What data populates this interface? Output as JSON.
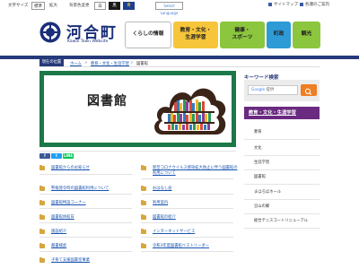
{
  "utility": {
    "text_size_label": "文字サイズ",
    "size_standard": "標準",
    "size_large": "拡大",
    "bg_color_label": "背景色変更",
    "color_white": "白",
    "color_black": "黒",
    "color_blue": "青",
    "language_button": "Select Language",
    "sitemap": "サイトマップ",
    "contact": "各課のご案内"
  },
  "logo": {
    "name": "河合町",
    "subtitle": "Kawai Town Website"
  },
  "global_nav": [
    {
      "label": "くらしの情報"
    },
    {
      "label": "教育・文化・生涯学習"
    },
    {
      "label": "健康・スポーツ"
    },
    {
      "label": "町政"
    },
    {
      "label": "観光"
    }
  ],
  "breadcrumb": {
    "position_label": "現在の位置",
    "items": [
      "ホーム",
      "教育・文化・生涯学習",
      "図書館"
    ],
    "separator": ">"
  },
  "hero": {
    "title": "図書館"
  },
  "social": {
    "facebook": "f",
    "twitter": "t",
    "line": "LINE"
  },
  "links": [
    [
      "図書館からのお知らせ",
      "新型コロナウイルス感染拡大防止に伴う図書館の利用について"
    ],
    [
      "警報発令時の図書館利用について",
      "おはなし会"
    ],
    [
      "図書館特設コーナー",
      "利用案内"
    ],
    [
      "図書館休館日",
      "図書館の紹介"
    ],
    [
      "施設紹介",
      "インターネットサービス"
    ],
    [
      "蔵書検索",
      "令和3年度図書館ベストリーダー"
    ],
    [
      "子育て支援図書室事業",
      ""
    ]
  ],
  "sidebar": {
    "keyword_title": "キーワード検索",
    "search_placeholder": "Google 提供",
    "search_brand": "Google",
    "section_title": "教育・文化・生涯学習",
    "items": [
      {
        "label": "教育",
        "sub": false
      },
      {
        "label": "文化",
        "sub": false
      },
      {
        "label": "生涯学習",
        "sub": false
      },
      {
        "label": "図書館",
        "sub": false
      },
      {
        "label": "まほろばホール",
        "sub": true
      },
      {
        "label": "豆山の郷",
        "sub": true
      },
      {
        "label": "総合テニスコートリニューアル",
        "sub": true
      }
    ]
  },
  "colors": {
    "navy": "#26397a",
    "edu_yellow": "#f6c53a",
    "health_green": "#8cc63e",
    "gov_blue": "#2e9ad6",
    "hero_green": "#1c7848",
    "sidebar_purple": "#6a2a80",
    "search_orange": "#ef7d22"
  }
}
